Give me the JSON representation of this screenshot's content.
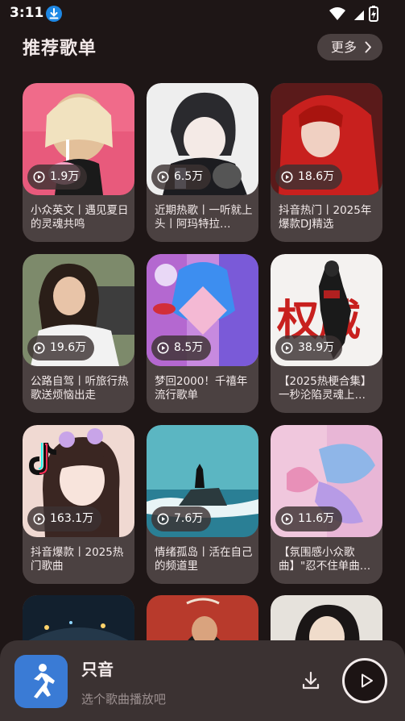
{
  "status_bar": {
    "time": "3:11"
  },
  "section": {
    "title": "推荐歌单",
    "more_label": "更多"
  },
  "playlists": [
    {
      "plays": "1.9万",
      "title": "小众英文丨遇见夏日的灵魂共鸣"
    },
    {
      "plays": "6.5万",
      "title": "近期热歌丨一听就上头丨阿玛特拉…"
    },
    {
      "plays": "18.6万",
      "title": "抖音热门丨2025年爆款DJ精选"
    },
    {
      "plays": "19.6万",
      "title": "公路自驾丨听旅行热歌送烦恼出走"
    },
    {
      "plays": "8.5万",
      "title": "梦回2000！千禧年流行歌单"
    },
    {
      "plays": "38.9万",
      "title": "【2025热梗合集】一秒沦陷灵魂上…"
    },
    {
      "plays": "163.1万",
      "title": "抖音爆款丨2025热门歌曲"
    },
    {
      "plays": "7.6万",
      "title": "情绪孤岛丨活在自己的频道里"
    },
    {
      "plays": "11.6万",
      "title": "【氛围感小众歌曲】\"忍不住单曲…"
    }
  ],
  "cover_text": {
    "quanwei": "权威"
  },
  "player": {
    "app_name": "只音",
    "subtitle": "选个歌曲播放吧"
  },
  "colors": {
    "background": "#1e1616",
    "card": "#4b4141",
    "player": "#3b3232",
    "accent": "#3a7bd5"
  }
}
